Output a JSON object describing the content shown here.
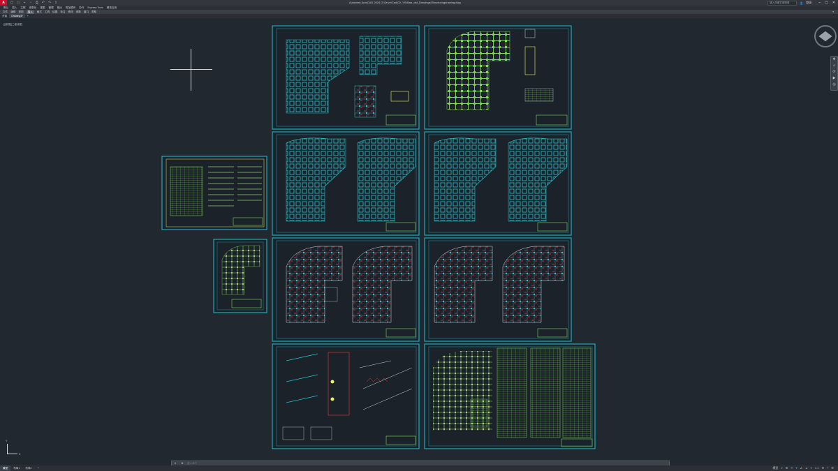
{
  "app": {
    "logo": "A",
    "window_title": "Autodesk AutoCAD 2024  D:\\Drive\\Cad\\02_YS\\Mep_dsf_Drawings\\Structuringdrawing.dwg",
    "search_placeholder": "键入关键字或短语",
    "user": "登录"
  },
  "menu": [
    "默认",
    "插入",
    "注释",
    "参数化",
    "视图",
    "管理",
    "输出",
    "附加模块",
    "协作",
    "Express Tools",
    "精选应用"
  ],
  "ribbon_tabs": [
    "文件",
    "编辑",
    "视图",
    "插入",
    "格式",
    "工具",
    "绘图",
    "标注",
    "修改",
    "参数",
    "窗口",
    "帮助"
  ],
  "ribbon_active": "插入",
  "doc_tabs": [
    "开始",
    "Drawing1*",
    "+"
  ],
  "doc_tab_active": "Drawing1*",
  "view_label": "[-][俯视][二维线框]",
  "command_placeholder": "键入命令",
  "status_tabs": [
    "模型",
    "布局1",
    "布局2"
  ],
  "status_active": "模型",
  "status_tools": [
    "模型",
    "#",
    "⊞",
    "⟲",
    "⌖",
    "∠",
    "⊿",
    "≡",
    "1:1",
    "⚙",
    "+",
    "☰"
  ],
  "icons": {
    "qat": [
      "new-icon",
      "open-icon",
      "save-icon",
      "saveas-icon",
      "print-icon",
      "undo-icon",
      "redo-icon",
      "share-icon"
    ],
    "nav": [
      "pan-icon",
      "zoom-icon",
      "orbit-icon",
      "showmotion-icon",
      "fullnav-icon"
    ],
    "status": [
      "grid-icon",
      "snap-icon",
      "ortho-icon",
      "polar-icon",
      "osnap-icon",
      "dynamic-ucs-icon",
      "lineweight-icon",
      "transparency-icon",
      "annotation-scale-icon",
      "workspace-icon",
      "customize-icon"
    ]
  },
  "colors": {
    "background": "#212830",
    "sheet_border": "#1fa9b8",
    "linework_green": "#7ed957",
    "linework_cyan": "#27c3cf",
    "linework_red": "#e0403a",
    "linework_yellow": "#e9f26a",
    "accent_red": "#c8102e"
  }
}
